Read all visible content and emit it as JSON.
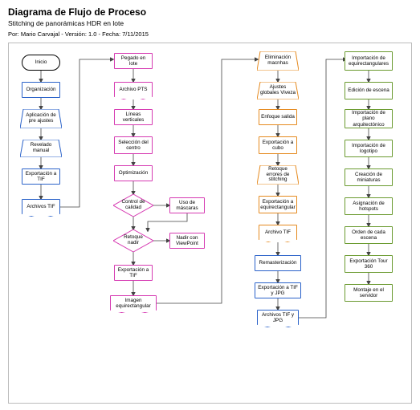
{
  "header": {
    "title": "Diagrama de Flujo de Proceso",
    "subtitle": "Stitching de panorámicas HDR en lote",
    "meta": "Por: Mario Carvajal - Versión: 1.0 - Fecha: 7/11/2015"
  },
  "col1": {
    "start": "Inicio",
    "n1": "Organización",
    "n2": "Aplicación de pre ajustes",
    "n3": "Revelado manual",
    "n4": "Exportación a TIF",
    "doc": "Archivos TIF"
  },
  "col2": {
    "n1": "Pegado en lote",
    "doc1": "Archivo PTS",
    "n2": "Líneas verticales",
    "n3": "Selección del centro",
    "n4": "Optimización",
    "d1": "Control de calidad",
    "side1": "Uso de máscaras",
    "d2": "Retoque nadir",
    "side2": "Nadir con ViewPoint",
    "n5": "Exportación a TIF",
    "doc2": "Imagen equirectangular"
  },
  "col3": {
    "n1": "Eliminación macnhas",
    "n2": "Ajustes globales Viveza",
    "n3": "Enfoque salida",
    "n4": "Exportación a cubo",
    "n5": "Retoque errores de stitching",
    "n6": "Exportación a equirectangular",
    "doc1": "Archivo TIF",
    "n7": "Remasterización",
    "n8": "Exportación a TIF y JPG",
    "doc2": "Archivos TIF y JPG"
  },
  "col4": {
    "n1": "Importación de equirectangulares",
    "n2": "Edición de escena",
    "n3": "Importación de plano arquitectónico",
    "n4": "Importación de logotipo",
    "n5": "Creación de miniaturas",
    "n6": "Asignación de hotspots",
    "n7": "Orden de cada escena",
    "n8": "Exportación Tour 360",
    "n9": "Montaje en el servidor"
  }
}
